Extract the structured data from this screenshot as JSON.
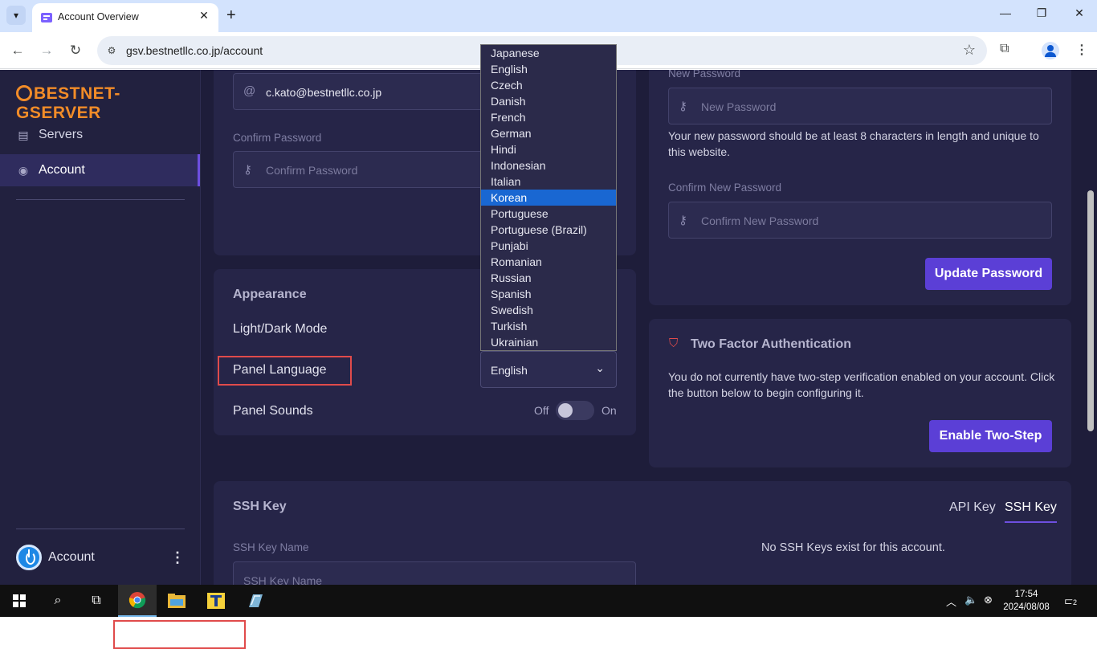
{
  "browser": {
    "tab_title": "Account Overview",
    "url": "gsv.bestnetllc.co.jp/account"
  },
  "sidebar": {
    "brand": "BESTNET-GSERVER",
    "items": [
      {
        "label": "Servers",
        "icon": "server-icon"
      },
      {
        "label": "Account",
        "icon": "user-circle-icon",
        "active": true
      }
    ],
    "user": {
      "name": "Account"
    }
  },
  "account_card": {
    "email_value": "c.kato@bestnetllc.co.jp",
    "confirm_password_label": "Confirm Password",
    "confirm_password_placeholder": "Confirm Password"
  },
  "appearance": {
    "title": "Appearance",
    "mode_label": "Light/Dark Mode",
    "language_label": "Panel Language",
    "language_value": "English",
    "sounds_label": "Panel Sounds",
    "sounds_off": "Off",
    "sounds_on": "On",
    "sounds_enabled": false
  },
  "language_dropdown": {
    "options": [
      "Japanese",
      "English",
      "Czech",
      "Danish",
      "French",
      "German",
      "Hindi",
      "Indonesian",
      "Italian",
      "Korean",
      "Portuguese",
      "Portuguese (Brazil)",
      "Punjabi",
      "Romanian",
      "Russian",
      "Spanish",
      "Swedish",
      "Turkish",
      "Ukrainian"
    ],
    "highlighted": "Korean"
  },
  "password_card": {
    "new_password_label": "New Password",
    "new_password_placeholder": "New Password",
    "help": "Your new password should be at least 8 characters in length and unique to this website.",
    "confirm_new_label": "Confirm New Password",
    "confirm_new_placeholder": "Confirm New Password",
    "button": "Update Password"
  },
  "two_factor": {
    "title": "Two Factor Authentication",
    "text": "You do not currently have two-step verification enabled on your account. Click the button below to begin configuring it.",
    "button": "Enable Two-Step"
  },
  "ssh": {
    "title": "SSH Key",
    "tabs": [
      "API Key",
      "SSH Key"
    ],
    "active_tab": "SSH Key",
    "name_label": "SSH Key Name",
    "name_placeholder": "SSH Key Name",
    "empty": "No SSH Keys exist for this account."
  },
  "taskbar": {
    "time": "17:54",
    "date": "2024/08/08",
    "notifications": "2"
  },
  "colors": {
    "page_bg": "#1e1d3a",
    "card_bg": "#262548",
    "accent": "#5b3fd6",
    "brand": "#f28c28",
    "highlight": "#e04b4b"
  }
}
